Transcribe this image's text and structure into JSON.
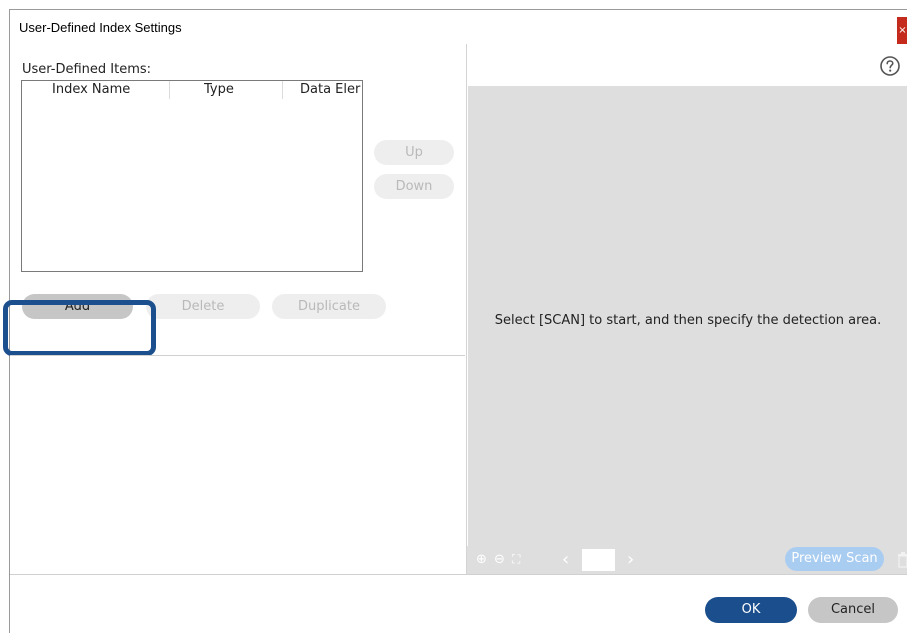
{
  "window": {
    "title": "User-Defined Index Settings",
    "close_glyph": "×"
  },
  "left": {
    "items_label": "User-Defined Items:",
    "columns": [
      "Index Name",
      "Type",
      "Data Eler"
    ],
    "rows": [],
    "buttons": {
      "up": "Up",
      "down": "Down",
      "add": "Add",
      "delete": "Delete",
      "duplicate": "Duplicate"
    }
  },
  "right": {
    "help_icon": "question-circle-icon",
    "preview_message": "Select [SCAN] to start, and then specify the detection area.",
    "toolbar": {
      "zoom_in_icon": "⊕",
      "zoom_out_icon": "⊖",
      "fit_icon": "⛶",
      "prev_icon": "‹",
      "next_icon": "›",
      "preview_scan": "Preview Scan"
    }
  },
  "footer": {
    "ok": "OK",
    "cancel": "Cancel"
  },
  "colors": {
    "accent": "#1b4e8c",
    "highlight_border": "#1c4f8e",
    "close": "#c42b1c",
    "preview_scan": "#a9ccf1",
    "preview_bg": "#dedede"
  }
}
